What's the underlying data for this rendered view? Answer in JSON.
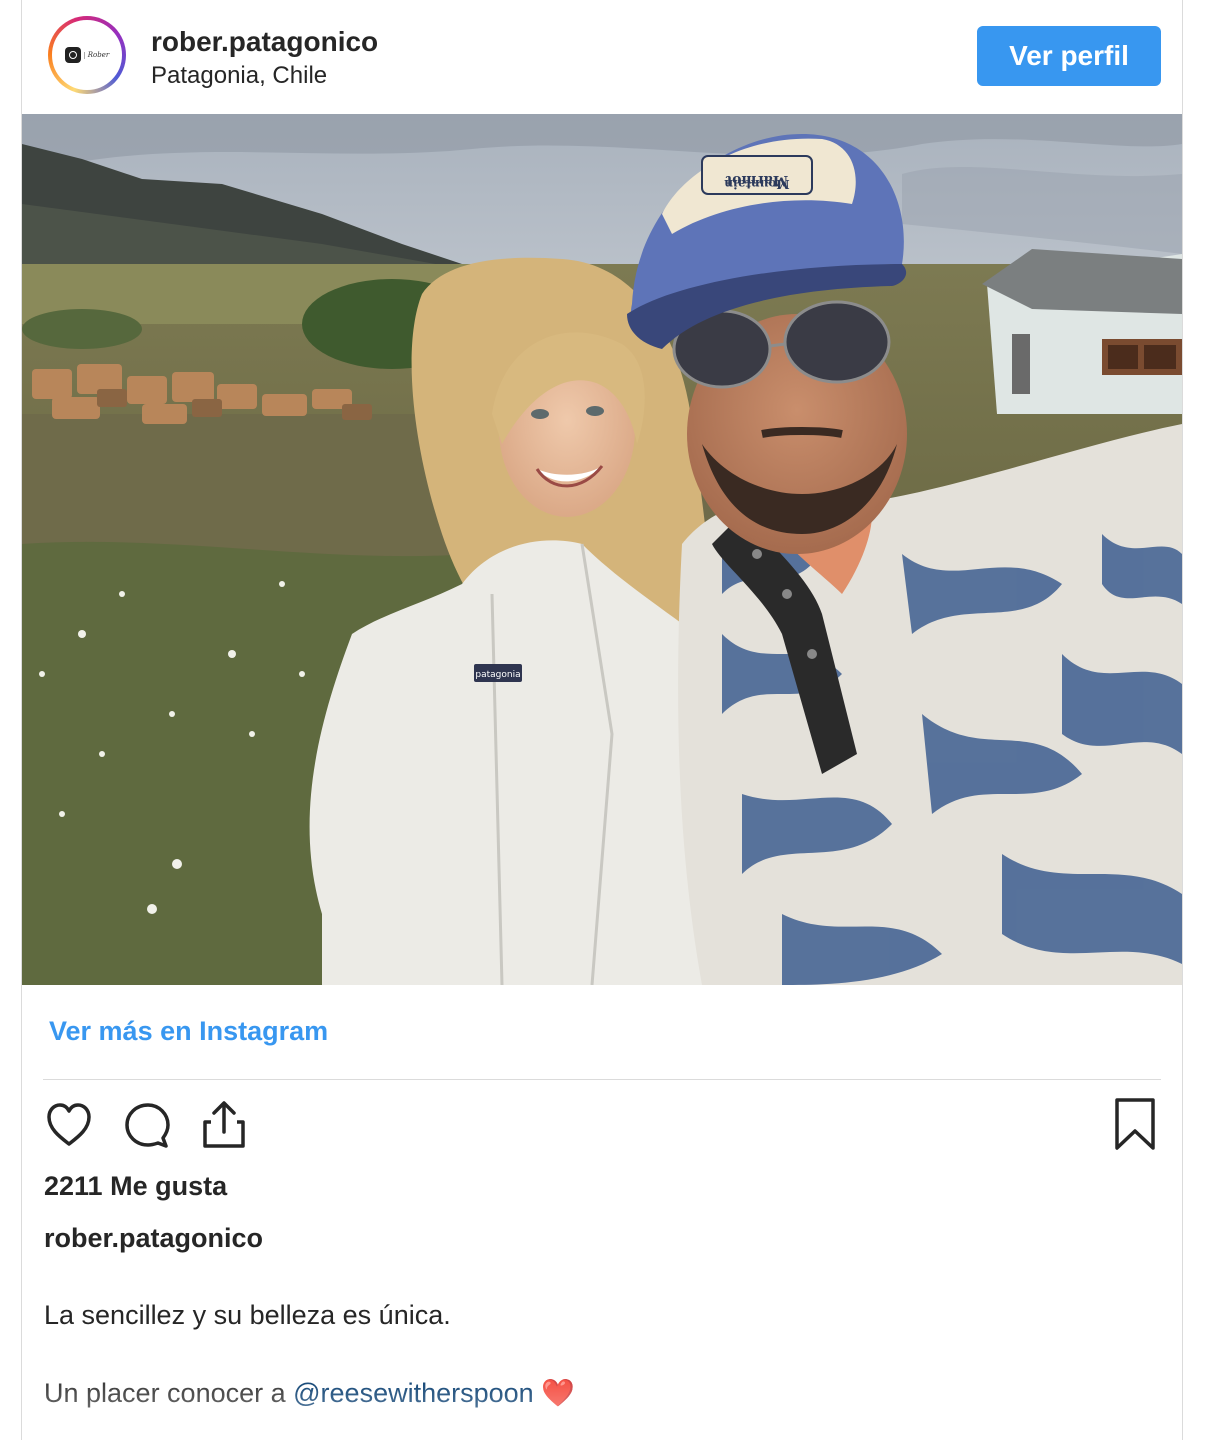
{
  "header": {
    "avatar_text": "Rober",
    "username": "rober.patagonico",
    "location": "Patagonia, Chile",
    "profile_button": "Ver perfil"
  },
  "photo": {
    "cap_text_line1": "Marmot",
    "cap_text_line2": "Mountain",
    "jacket_logo": "patagonia"
  },
  "links": {
    "more_on_instagram": "Ver más en Instagram"
  },
  "actions": {
    "icons": [
      "heart-icon",
      "comment-icon",
      "share-icon",
      "bookmark-icon"
    ]
  },
  "stats": {
    "likes": "2211 Me gusta"
  },
  "caption": {
    "username": "rober.patagonico",
    "line1": "La sencillez y su belleza es única.",
    "line2_prefix": "Un placer conocer a ",
    "mention": "@reesewitherspoon",
    "emoji": "❤️"
  },
  "colors": {
    "accent": "#3897f0",
    "mention": "#00376b",
    "text": "#262626",
    "divider": "#dbdbdb"
  }
}
